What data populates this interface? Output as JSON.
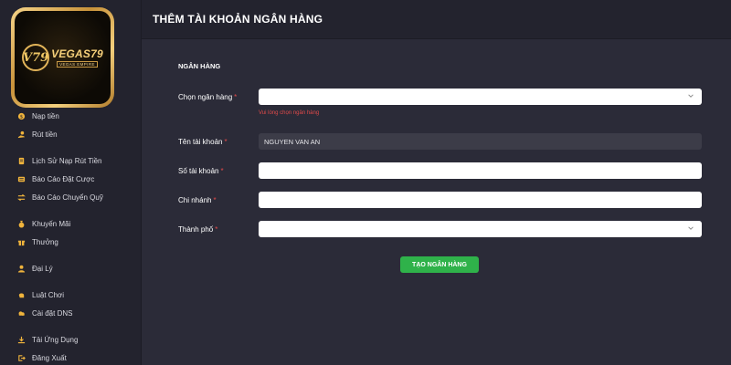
{
  "logo": {
    "emblem": "V79",
    "brand": "VEGAS79",
    "tagline": "VEGAS EMPIRE"
  },
  "sidebar": {
    "items": [
      {
        "label": "Nạp tiền",
        "icon": "coin-icon"
      },
      {
        "label": "Rút tiền",
        "icon": "hand-coin-icon"
      },
      {
        "label": "Lịch Sử Nạp Rút Tiền",
        "icon": "document-icon"
      },
      {
        "label": "Báo Cáo Đặt Cược",
        "icon": "list-icon"
      },
      {
        "label": "Báo Cáo Chuyển Quỹ",
        "icon": "transfer-icon"
      },
      {
        "label": "Khuyến Mãi",
        "icon": "money-bag-icon"
      },
      {
        "label": "Thưởng",
        "icon": "gift-icon"
      },
      {
        "label": "Đại Lý",
        "icon": "user-icon"
      },
      {
        "label": "Luật Chơi",
        "icon": "hand-icon"
      },
      {
        "label": "Cài đặt DNS",
        "icon": "cloud-icon"
      },
      {
        "label": "Tải Ứng Dụng",
        "icon": "download-icon"
      },
      {
        "label": "Đăng Xuất",
        "icon": "logout-icon"
      }
    ]
  },
  "header": {
    "title": "THÊM TÀI KHOẢN NGÂN HÀNG"
  },
  "form": {
    "section_title": "NGÂN HÀNG",
    "bank": {
      "label": "Chọn ngân hàng",
      "value": "",
      "error": "Vui lòng chọn ngân hàng"
    },
    "account_name": {
      "label": "Tên tài khoản",
      "value": "NGUYEN VAN AN"
    },
    "account_number": {
      "label": "Số tài khoản",
      "value": ""
    },
    "branch": {
      "label": "Chi nhánh",
      "value": ""
    },
    "city": {
      "label": "Thành phố",
      "value": ""
    },
    "required_mark": "*",
    "submit_label": "TẠO NGÂN HÀNG"
  },
  "colors": {
    "accent": "#2fb24a",
    "error": "#e14a4a",
    "icon": "#f0b43c",
    "background": "#2b2b38",
    "sidebar": "#23232e"
  }
}
